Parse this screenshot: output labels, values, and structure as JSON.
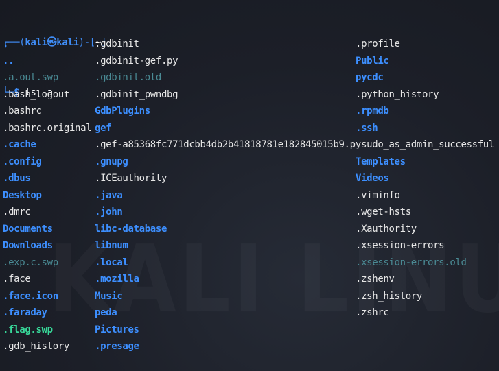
{
  "prompt": {
    "corner_top": "┌──",
    "open_paren": "(",
    "user_host": "kali㉿kali",
    "close_paren": ")-[",
    "cwd": "~",
    "close_bracket": "]",
    "corner_bottom": "└─",
    "symbol": "$",
    "command": "ls -a"
  },
  "columns": [
    [
      {
        "name": ".",
        "type": "dir"
      },
      {
        "name": "..",
        "type": "dir"
      },
      {
        "name": ".a.out.swp",
        "type": "swp"
      },
      {
        "name": ".bash_logout",
        "type": "file"
      },
      {
        "name": ".bashrc",
        "type": "file"
      },
      {
        "name": ".bashrc.original",
        "type": "file"
      },
      {
        "name": ".cache",
        "type": "dir"
      },
      {
        "name": ".config",
        "type": "dir"
      },
      {
        "name": ".dbus",
        "type": "dir"
      },
      {
        "name": "Desktop",
        "type": "dir"
      },
      {
        "name": ".dmrc",
        "type": "file"
      },
      {
        "name": "Documents",
        "type": "dir"
      },
      {
        "name": "Downloads",
        "type": "dir"
      },
      {
        "name": ".exp.c.swp",
        "type": "swp"
      },
      {
        "name": ".face",
        "type": "file"
      },
      {
        "name": ".face.icon",
        "type": "dir"
      },
      {
        "name": ".faraday",
        "type": "dir"
      },
      {
        "name": ".flag.swp",
        "type": "special"
      },
      {
        "name": ".gdb_history",
        "type": "file"
      }
    ],
    [
      {
        "name": ".gdbinit",
        "type": "file"
      },
      {
        "name": ".gdbinit-gef.py",
        "type": "file"
      },
      {
        "name": ".gdbinit.old",
        "type": "swp"
      },
      {
        "name": ".gdbinit_pwndbg",
        "type": "file"
      },
      {
        "name": "GdbPlugins",
        "type": "dir"
      },
      {
        "name": "gef",
        "type": "dir"
      },
      {
        "name": ".gef-a85368fc771dcbb4db2b41818781e182845015b9.py",
        "type": "file"
      },
      {
        "name": ".gnupg",
        "type": "dir"
      },
      {
        "name": ".ICEauthority",
        "type": "file"
      },
      {
        "name": ".java",
        "type": "dir"
      },
      {
        "name": ".john",
        "type": "dir"
      },
      {
        "name": "libc-database",
        "type": "dir"
      },
      {
        "name": "libnum",
        "type": "dir"
      },
      {
        "name": ".local",
        "type": "dir"
      },
      {
        "name": ".mozilla",
        "type": "dir"
      },
      {
        "name": "Music",
        "type": "dir"
      },
      {
        "name": "peda",
        "type": "dir"
      },
      {
        "name": "Pictures",
        "type": "dir"
      },
      {
        "name": ".presage",
        "type": "dir"
      }
    ],
    [
      {
        "name": ".profile",
        "type": "file"
      },
      {
        "name": "Public",
        "type": "dir"
      },
      {
        "name": "pycdc",
        "type": "dir"
      },
      {
        "name": ".python_history",
        "type": "file"
      },
      {
        "name": ".rpmdb",
        "type": "dir"
      },
      {
        "name": ".ssh",
        "type": "dir"
      },
      {
        "name": ".sudo_as_admin_successful",
        "type": "file"
      },
      {
        "name": "Templates",
        "type": "dir"
      },
      {
        "name": "Videos",
        "type": "dir"
      },
      {
        "name": ".viminfo",
        "type": "file"
      },
      {
        "name": ".wget-hsts",
        "type": "file"
      },
      {
        "name": ".Xauthority",
        "type": "file"
      },
      {
        "name": ".xsession-errors",
        "type": "file"
      },
      {
        "name": ".xsession-errors.old",
        "type": "swp"
      },
      {
        "name": ".zshenv",
        "type": "file"
      },
      {
        "name": ".zsh_history",
        "type": "file"
      },
      {
        "name": ".zshrc",
        "type": "file"
      }
    ]
  ],
  "watermark": "KALI LINUX",
  "colors": {
    "background": "#1c1f28",
    "prompt_accent": "#3f8cf5",
    "directory": "#3d8fff",
    "file": "#e6e6e6",
    "swap_file": "#4a8a94",
    "special_file": "#38d99a"
  }
}
